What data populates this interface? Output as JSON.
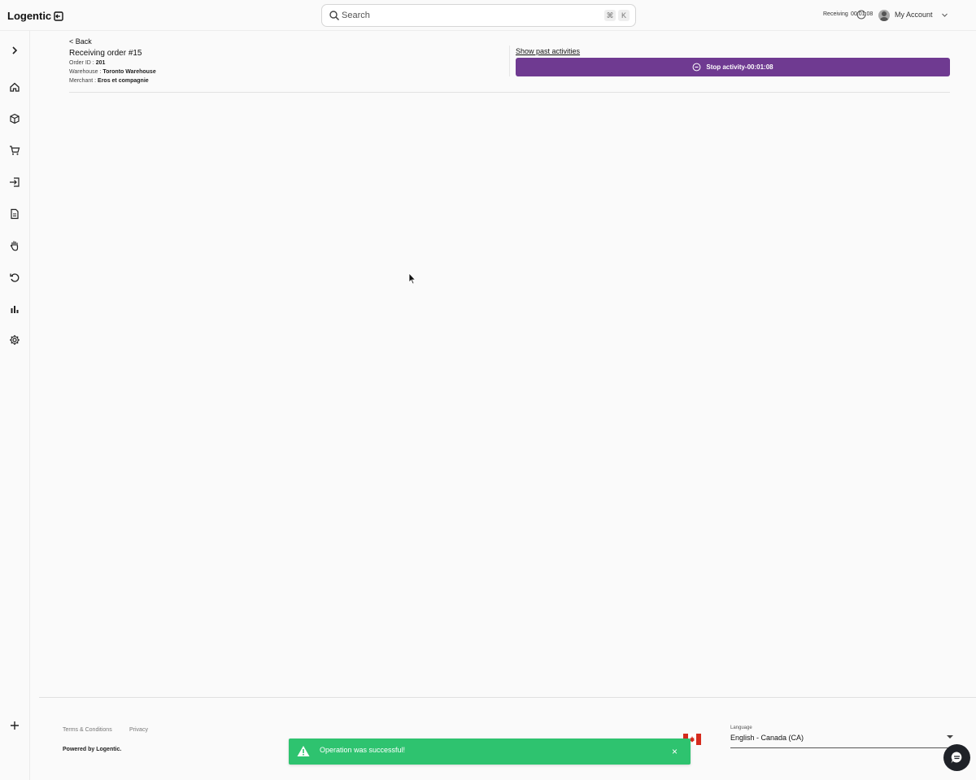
{
  "app": {
    "logo_text": "Logentic"
  },
  "search": {
    "placeholder": "Search",
    "shortcut_cmd": "⌘",
    "shortcut_key": "K"
  },
  "header": {
    "activity_label": "Receiving",
    "activity_time": "00:01:08",
    "account_label": "My Account"
  },
  "sidebar": {
    "items": [
      {
        "icon": "chevron-right-icon"
      },
      {
        "icon": "home-icon"
      },
      {
        "icon": "box-icon"
      },
      {
        "icon": "cart-icon"
      },
      {
        "icon": "inbound-icon"
      },
      {
        "icon": "document-icon"
      },
      {
        "icon": "hand-icon"
      },
      {
        "icon": "return-icon"
      },
      {
        "icon": "chart-icon"
      },
      {
        "icon": "settings-icon"
      },
      {
        "icon": "plus-icon"
      }
    ]
  },
  "page": {
    "back_label": "< Back",
    "title": "Receiving order #15",
    "order_id_label": "Order ID :",
    "order_id": "201",
    "warehouse_label": "Warehouse :",
    "warehouse": "Toronto Warehouse",
    "merchant_label": "Merchant :",
    "merchant": "Eros et compagnie",
    "show_past": "Show past activities",
    "stop_button": "Stop activity-00:01:08"
  },
  "footer": {
    "terms": "Terms & Conditions",
    "privacy": "Privacy",
    "powered": "Powered by Logentic.",
    "language_label": "Language",
    "language_value": "English - Canada (CA)"
  },
  "toast": {
    "message": "Operation was successful!",
    "close": "×"
  },
  "colors": {
    "accent": "#6f3a91",
    "success": "#2ec36f",
    "chat": "#1f2228"
  }
}
